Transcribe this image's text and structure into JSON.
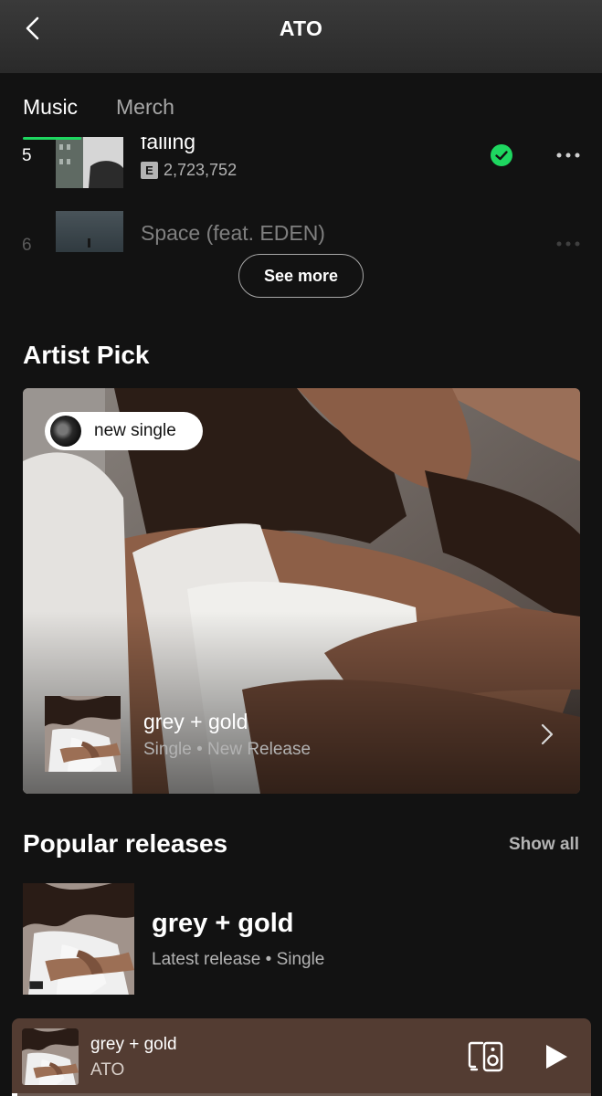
{
  "header": {
    "title": "ATO",
    "back_icon": "chevron-left-icon"
  },
  "tabs": [
    {
      "label": "Music",
      "active": true
    },
    {
      "label": "Merch",
      "active": false
    }
  ],
  "accent_color": "#1ed760",
  "tracks": [
    {
      "number": "5",
      "title": "falling",
      "explicit": "E",
      "plays": "2,723,752",
      "saved": true
    },
    {
      "number": "6",
      "title": "Space (feat. EDEN)",
      "saved": false
    }
  ],
  "see_more": {
    "label": "See more"
  },
  "artist_pick": {
    "section_title": "Artist Pick",
    "badge": "new single",
    "title": "grey + gold",
    "subtitle": "Single • New Release"
  },
  "popular_releases": {
    "section_title": "Popular releases",
    "show_all": "Show all",
    "items": [
      {
        "title": "grey + gold",
        "subtitle": "Latest release • Single"
      }
    ]
  },
  "now_playing": {
    "title": "grey + gold",
    "artist": "ATO",
    "progress": 0.01,
    "background": "#533c32"
  }
}
